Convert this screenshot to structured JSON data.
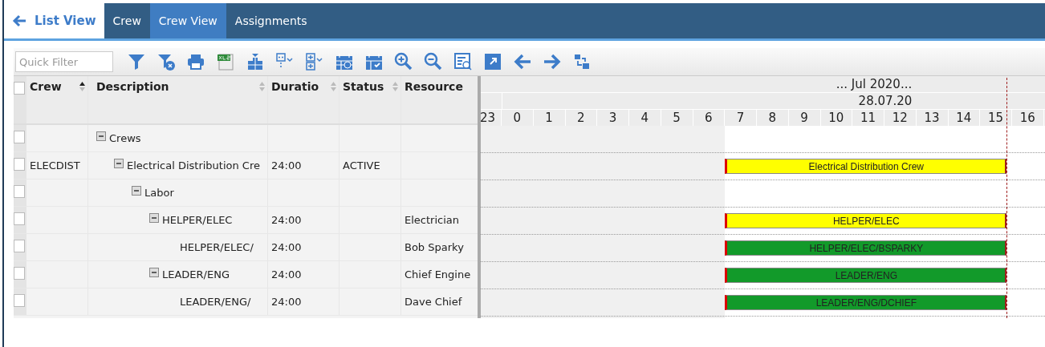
{
  "nav": {
    "back": {
      "label": "List View"
    },
    "tabs": [
      {
        "label": "Crew",
        "selected": false
      },
      {
        "label": "Crew View",
        "selected": true
      },
      {
        "label": "Assignments",
        "selected": false
      }
    ]
  },
  "toolbar": {
    "quick_filter": {
      "placeholder": "Quick Filter"
    }
  },
  "grid": {
    "select_all": {
      "checked": false
    },
    "columns": [
      {
        "label": "Crew",
        "sorted": true
      },
      {
        "label": "Description",
        "sorted": false
      },
      {
        "label": "Duratio",
        "sorted": false
      },
      {
        "label": "Status",
        "sorted": false
      },
      {
        "label": "Resource"
      }
    ],
    "rows": [
      {
        "description": "Crews",
        "checked": false,
        "expanded": true,
        "children": [
          {
            "crew": "ELECDIST",
            "description": "Electrical Distribution Cre",
            "duration": "24:00",
            "status": "ACTIVE",
            "checked": false,
            "expanded": true,
            "bar": {
              "label": "Electrical Distribution Crew",
              "color": "#ffff00"
            },
            "children": [
              {
                "description": "Labor",
                "checked": false,
                "expanded": true,
                "children": [
                  {
                    "description": "HELPER/ELEC",
                    "duration": "24:00",
                    "resources": "Electrician",
                    "checked": false,
                    "expanded": true,
                    "bar": {
                      "label": "HELPER/ELEC",
                      "color": "#ffff00"
                    },
                    "children": [
                      {
                        "description": "HELPER/ELEC/",
                        "duration": "24:00",
                        "resources": "Bob Sparky",
                        "checked": false,
                        "bar": {
                          "label": "HELPER/ELEC/BSPARKY",
                          "color": "#129a2a"
                        }
                      }
                    ]
                  },
                  {
                    "description": "LEADER/ENG",
                    "duration": "24:00",
                    "resources": "Chief Engine",
                    "checked": false,
                    "expanded": true,
                    "bar": {
                      "label": "LEADER/ENG",
                      "color": "#129a2a"
                    },
                    "children": [
                      {
                        "description": "LEADER/ENG/",
                        "duration": "24:00",
                        "resources": "Dave Chief",
                        "checked": false,
                        "bar": {
                          "label": "LEADER/ENG/DCHIEF",
                          "color": "#129a2a"
                        }
                      }
                    ]
                  }
                ]
              }
            ]
          }
        ]
      }
    ]
  },
  "gantt": {
    "month": "... Jul 2020...",
    "day": "28.07.20",
    "hours": [
      "23",
      "0",
      "1",
      "2",
      "3",
      "4",
      "5",
      "6",
      "7",
      "8",
      "9",
      "10",
      "11",
      "12",
      "13",
      "14",
      "15",
      "16"
    ]
  }
}
